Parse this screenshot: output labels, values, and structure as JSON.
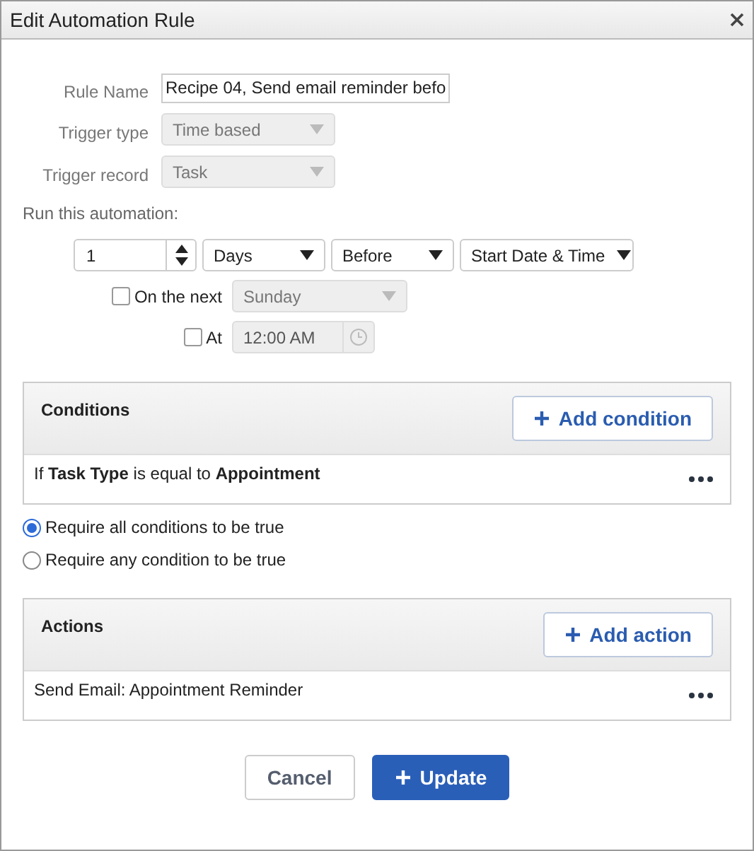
{
  "window": {
    "title": "Edit Automation Rule"
  },
  "form": [
    {
      "label": "Rule Name",
      "kind": "text",
      "value": "Recipe 04, Send email reminder befo"
    },
    {
      "label": "Trigger type",
      "kind": "select",
      "value": "Time based",
      "disabled": true
    },
    {
      "label": "Trigger record",
      "kind": "select",
      "value": "Task",
      "disabled": true
    }
  ],
  "schedule": {
    "heading": "Run this automation:",
    "amount": "1",
    "selects": [
      {
        "value": "Days",
        "disabled": false
      },
      {
        "value": "Before",
        "disabled": false
      },
      {
        "value": "Start Date & Time",
        "disabled": false
      }
    ],
    "on_the_next": {
      "label": "On the next",
      "checked": false,
      "value": "Sunday",
      "disabled": true
    },
    "at": {
      "label": "At",
      "checked": false,
      "value": "12:00 AM",
      "disabled": true
    }
  },
  "conditions": {
    "title": "Conditions",
    "button": "Add condition",
    "items": [
      "If **Task Type** is equal to **Appointment**"
    ]
  },
  "match": [
    {
      "label": "Require all conditions to be true",
      "selected": true
    },
    {
      "label": "Require any condition to be true",
      "selected": false
    }
  ],
  "actions": {
    "title": "Actions",
    "button": "Add action",
    "items": [
      "Send Email: Appointment Reminder"
    ]
  },
  "buttons": [
    {
      "label": "Cancel",
      "kind": "secondary"
    },
    {
      "label": "Update",
      "kind": "primary"
    }
  ]
}
